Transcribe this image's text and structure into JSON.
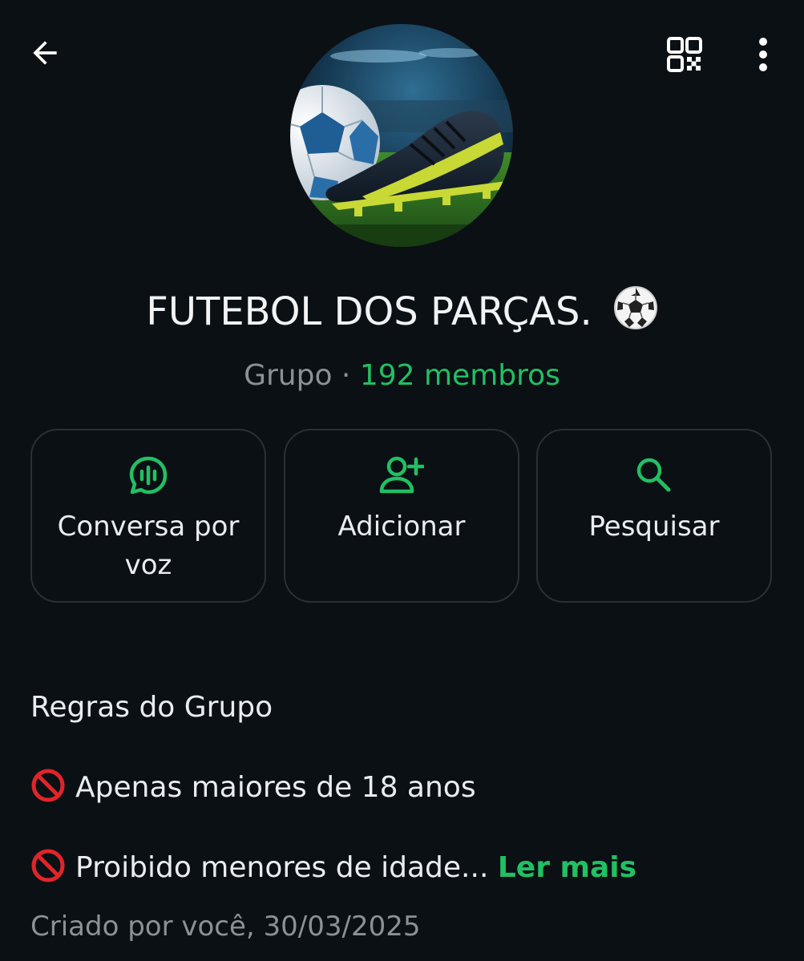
{
  "header": {
    "back_icon": "arrow-left-icon",
    "qr_icon": "qr-code-icon",
    "menu_icon": "more-vertical-icon"
  },
  "group": {
    "name": "FUTEBOL DOS PARÇAS.",
    "name_emoji": "soccer-ball-emoji",
    "type": "Grupo",
    "separator": "·",
    "members": "192 membros",
    "avatar": "soccer-ball-and-cleat-photo"
  },
  "actions": [
    {
      "label": "Conversa por voz",
      "icon": "voice-chat-icon"
    },
    {
      "label": "Adicionar",
      "icon": "add-person-icon"
    },
    {
      "label": "Pesquisar",
      "icon": "search-icon"
    }
  ],
  "description": {
    "title": "Regras do Grupo",
    "line1": "Apenas maiores de 18 anos",
    "line2": "Proibido menores de idade...",
    "prohibited_icon": "prohibited-icon",
    "read_more": "Ler mais"
  },
  "created": "Criado por você, 30/03/2025",
  "colors": {
    "background": "#0b1014",
    "accent": "#21c063",
    "muted_text": "#8a9296",
    "card_border": "#2a3035"
  }
}
